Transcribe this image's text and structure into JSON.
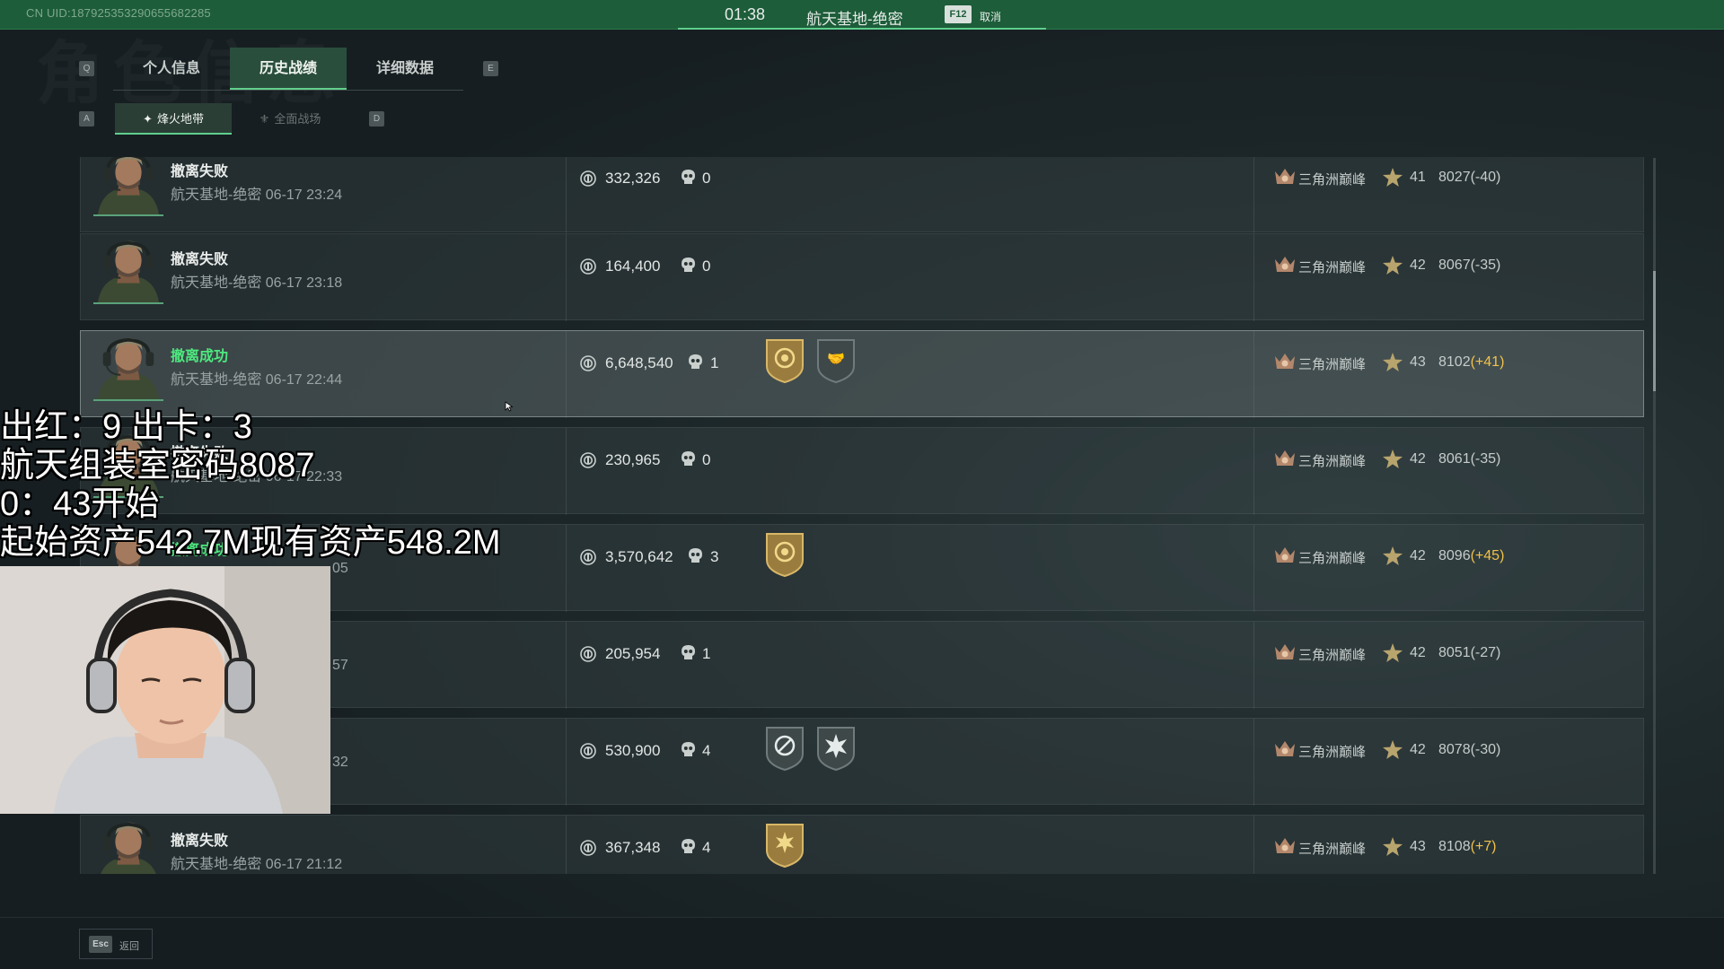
{
  "top_bar": {
    "uid": "CN UID:187925353290655682285",
    "timer": "01:38",
    "map": "航天基地-绝密",
    "cancel_key": "F12",
    "cancel_label": "取消"
  },
  "bg_title": "角色信息",
  "tabs": {
    "prev_key": "Q",
    "next_key": "E",
    "items": [
      {
        "label": "个人信息"
      },
      {
        "label": "历史战绩"
      },
      {
        "label": "详细数据"
      }
    ]
  },
  "subtabs": {
    "prev_key": "A",
    "next_key": "D",
    "items": [
      {
        "label": "烽火地带"
      },
      {
        "label": "全面战场"
      }
    ]
  },
  "matches": [
    {
      "status": "撤离失败",
      "meta": "航天基地-绝密 06-17 23:24",
      "value": "332,326",
      "kills": "0",
      "badges": [],
      "rank": "三角洲巅峰",
      "level": "41",
      "score": "8027",
      "delta": "(-40)",
      "delta_positive": false
    },
    {
      "status": "撤离失败",
      "meta": "航天基地-绝密 06-17 23:18",
      "value": "164,400",
      "kills": "0",
      "badges": [],
      "rank": "三角洲巅峰",
      "level": "42",
      "score": "8067",
      "delta": "(-35)",
      "delta_positive": false
    },
    {
      "status": "撤离成功",
      "meta": "航天基地-绝密 06-17 22:44",
      "value": "6,648,540",
      "kills": "1",
      "badges": [
        "gold-target-badge-icon",
        "handshake-badge-icon"
      ],
      "rank": "三角洲巅峰",
      "level": "43",
      "score": "8102",
      "delta": "(+41)",
      "delta_positive": true
    },
    {
      "status": "撤离失败",
      "meta": "航天基地-绝密 06-17 22:33",
      "value": "230,965",
      "kills": "0",
      "badges": [],
      "rank": "三角洲巅峰",
      "level": "42",
      "score": "8061",
      "delta": "(-35)",
      "delta_positive": false
    },
    {
      "status": "撤离成功",
      "meta": "05",
      "value": "3,570,642",
      "kills": "3",
      "badges": [
        "gold-target-badge-icon"
      ],
      "rank": "三角洲巅峰",
      "level": "42",
      "score": "8096",
      "delta": "(+45)",
      "delta_positive": true
    },
    {
      "status": "",
      "meta": "57",
      "value": "205,954",
      "kills": "1",
      "badges": [],
      "rank": "三角洲巅峰",
      "level": "42",
      "score": "8051",
      "delta": "(-27)",
      "delta_positive": false
    },
    {
      "status": "",
      "meta": "32",
      "value": "530,900",
      "kills": "4",
      "badges": [
        "crosshair-badge-icon",
        "explosion-badge-icon"
      ],
      "rank": "三角洲巅峰",
      "level": "42",
      "score": "8078",
      "delta": "(-30)",
      "delta_positive": false
    },
    {
      "status": "撤离失败",
      "meta": "航天基地-绝密 06-17 21:12",
      "value": "367,348",
      "kills": "4",
      "badges": [
        "gold-sun-badge-icon"
      ],
      "rank": "三角洲巅峰",
      "level": "43",
      "score": "8108",
      "delta": "(+7)",
      "delta_positive": true
    }
  ],
  "bottom": {
    "esc_key": "Esc",
    "esc_label": "返回"
  },
  "overlay_text": "出红：9 出卡：3\n航天组装室密码8087\n0：43开始\n起始资产542.7M现有资产548.2M",
  "colors": {
    "accent": "#5fcf8e",
    "win": "#4ee87f",
    "positive_delta": "#f0c14a",
    "top_bar": "#1d5d3a"
  }
}
